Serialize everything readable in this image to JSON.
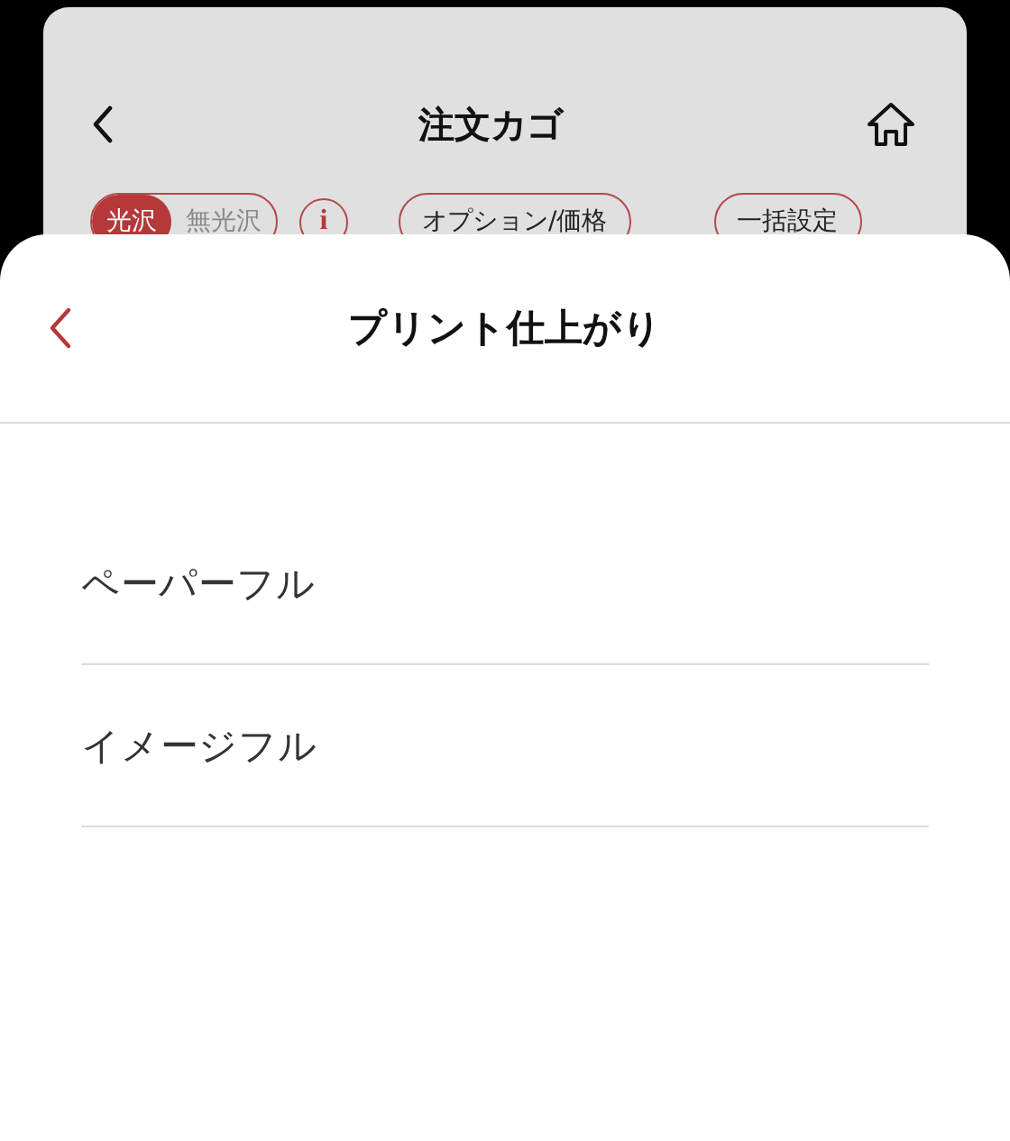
{
  "background_screen": {
    "title": "注文カゴ",
    "finish_toggle": [
      {
        "label": "光沢",
        "selected": true
      },
      {
        "label": "無光沢",
        "selected": false
      }
    ],
    "info": "i",
    "buttons": [
      "オプション/価格",
      "一括設定"
    ]
  },
  "sheet": {
    "title": "プリント仕上がり",
    "options": [
      {
        "label": "ペーパーフル"
      },
      {
        "label": "イメージフル"
      }
    ]
  }
}
